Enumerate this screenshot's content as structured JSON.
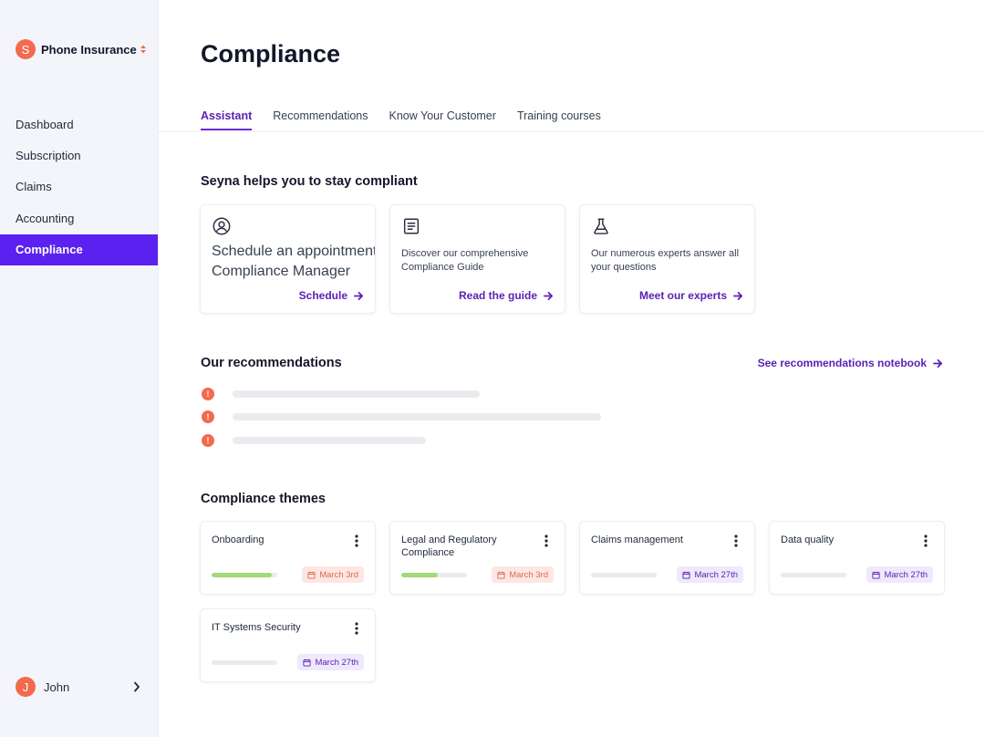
{
  "sidebar": {
    "org": {
      "initial": "S",
      "name": "Phone Insurance"
    },
    "items": [
      {
        "label": "Dashboard"
      },
      {
        "label": "Subscription"
      },
      {
        "label": "Claims"
      },
      {
        "label": "Accounting"
      },
      {
        "label": "Compliance",
        "active": true
      }
    ],
    "user": {
      "initial": "J",
      "name": "John"
    }
  },
  "page": {
    "title": "Compliance"
  },
  "tabs": [
    {
      "label": "Assistant",
      "active": true
    },
    {
      "label": "Recommendations"
    },
    {
      "label": "Know Your Customer"
    },
    {
      "label": "Training courses"
    }
  ],
  "assistant": {
    "title": "Seyna helps you to stay compliant",
    "cards": [
      {
        "icon": "user-circle-icon",
        "text": "Schedule an appointment with your Compliance Manager",
        "text_line1": "Schedule an appointment w",
        "text_line2": "Compliance Manager",
        "link": "Schedule"
      },
      {
        "icon": "document-icon",
        "text": "Discover our comprehensive Compliance Guide",
        "link": "Read the guide"
      },
      {
        "icon": "flask-icon",
        "text": "Our numerous experts answer all your questions",
        "link": "Meet our experts"
      }
    ]
  },
  "recommendations": {
    "title": "Our recommendations",
    "link": "See recommendations notebook",
    "items_count": 3
  },
  "themes": {
    "title": "Compliance themes",
    "items": [
      {
        "title": "Onboarding",
        "progress": 0.92,
        "date": "March 3rd",
        "status": "late"
      },
      {
        "title": "Legal and Regulatory Compliance",
        "progress": 0.55,
        "date": "March 3rd",
        "status": "late"
      },
      {
        "title": "Claims management",
        "progress": 0,
        "date": "March 27th",
        "status": "upcoming"
      },
      {
        "title": "Data quality",
        "progress": 0,
        "date": "March 27th",
        "status": "upcoming"
      },
      {
        "title": "IT Systems Security",
        "progress": 0,
        "date": "March 27th",
        "status": "upcoming"
      }
    ]
  },
  "colors": {
    "accent": "#5b21f0",
    "link": "#5b21b6",
    "alert": "#f46a4e",
    "progress": "#a3d977"
  }
}
